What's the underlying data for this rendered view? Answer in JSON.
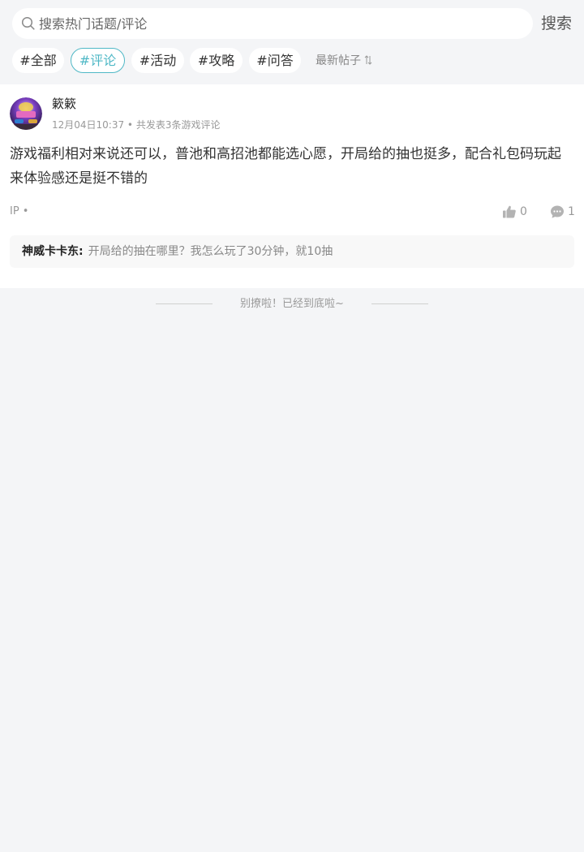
{
  "search": {
    "placeholder": "搜索热门话题/评论",
    "button_label": "搜索"
  },
  "tabs": [
    {
      "label": "#全部",
      "active": false
    },
    {
      "label": "#评论",
      "active": true
    },
    {
      "label": "#活动",
      "active": false
    },
    {
      "label": "#攻略",
      "active": false
    },
    {
      "label": "#问答",
      "active": false
    }
  ],
  "sort": {
    "label": "最新帖子",
    "icon": "sort-arrows-icon"
  },
  "post": {
    "username": "簌簌",
    "meta": "12月04日10:37 • 共发表3条游戏评论",
    "content": "游戏福利相对来说还可以，普池和高招池都能选心愿，开局给的抽也挺多，配合礼包码玩起来体验感还是挺不错的",
    "ip": "IP •",
    "likes": "0",
    "comments": "1",
    "reply": {
      "author": "神威卡卡东:",
      "text": "开局给的抽在哪里？我怎么玩了30分钟，就10抽"
    }
  },
  "footer": {
    "end_text": "别撩啦！已经到底啦~"
  },
  "colors": {
    "accent": "#4fb8c6",
    "background": "#f4f5f7",
    "muted_text": "#999999"
  }
}
